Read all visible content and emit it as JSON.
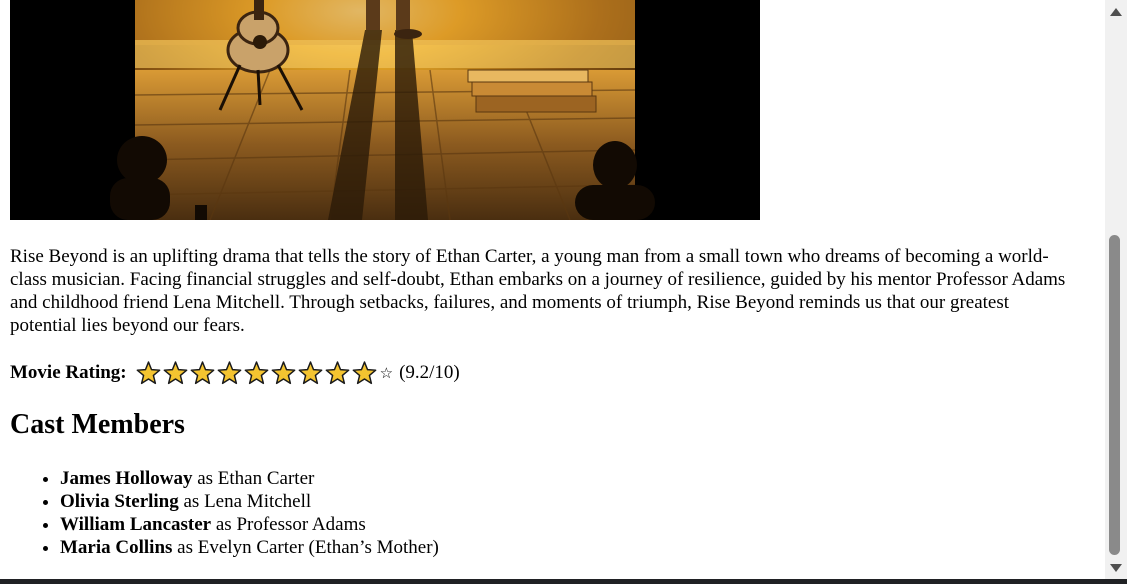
{
  "description": "Rise Beyond is an uplifting drama that tells the story of Ethan Carter, a young man from a small town who dreams of becoming a world-class musician. Facing financial struggles and self-doubt, Ethan embarks on a journey of resilience, guided by his mentor Professor Adams and childhood friend Lena Mitchell. Through setbacks, failures, and moments of triumph, Rise Beyond reminds us that our greatest potential lies beyond our fears.",
  "rating": {
    "label": "Movie Rating:",
    "filled_stars": 9,
    "total_stars": 10,
    "empty_star_glyph": "☆",
    "score_text": "(9.2/10)",
    "star_color": "#f4c430"
  },
  "cast": {
    "title": "Cast Members",
    "members": [
      {
        "actor": "James Holloway",
        "joiner": " as ",
        "role": "Ethan Carter"
      },
      {
        "actor": "Olivia Sterling",
        "joiner": " as ",
        "role": "Lena Mitchell"
      },
      {
        "actor": "William Lancaster",
        "joiner": " as ",
        "role": "Professor Adams"
      },
      {
        "actor": "Maria Collins",
        "joiner": " as ",
        "role": "Evelyn Carter (Ethan’s Mother)"
      }
    ]
  },
  "icons": {
    "scroll_up": "scroll-up-arrow-icon",
    "scroll_down": "scroll-down-arrow-icon",
    "star": "star-icon"
  }
}
